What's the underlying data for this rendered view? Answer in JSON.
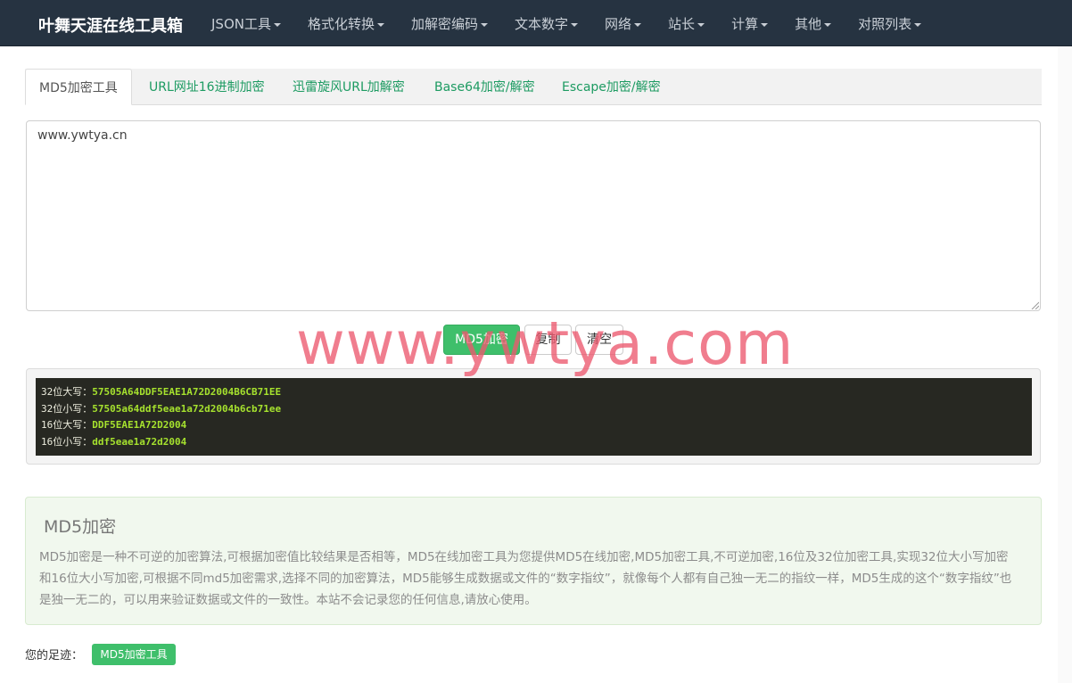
{
  "navbar": {
    "brand": "叶舞天涯在线工具箱",
    "items": [
      "JSON工具",
      "格式化转换",
      "加解密编码",
      "文本数字",
      "网络",
      "站长",
      "计算",
      "其他",
      "对照列表"
    ]
  },
  "tabs": [
    "MD5加密工具",
    "URL网址16进制加密",
    "迅雷旋风URL加解密",
    "Base64加密/解密",
    "Escape加密/解密"
  ],
  "input": {
    "value": "www.ywtya.cn"
  },
  "buttons": {
    "encrypt": "MD5加密",
    "copy": "复制",
    "clear": "清空"
  },
  "results": [
    {
      "label": "32位大写：",
      "value": "57505A64DDF5EAE1A72D2004B6CB71EE"
    },
    {
      "label": "32位小写：",
      "value": "57505a64ddf5eae1a72d2004b6cb71ee"
    },
    {
      "label": "16位大写：",
      "value": "DDF5EAE1A72D2004"
    },
    {
      "label": "16位小写：",
      "value": "ddf5eae1a72d2004"
    }
  ],
  "info": {
    "title": "MD5加密",
    "text": "MD5加密是一种不可逆的加密算法,可根据加密值比较结果是否相等，MD5在线加密工具为您提供MD5在线加密,MD5加密工具,不可逆加密,16位及32位加密工具,实现32位大小写加密和16位大小写加密,可根据不同md5加密需求,选择不同的加密算法，MD5能够生成数据或文件的“数字指纹”，就像每个人都有自己独一无二的指纹一样，MD5生成的这个“数字指纹”也是独一无二的，可以用来验证数据或文件的一致性。本站不会记录您的任何信息,请放心使用。"
  },
  "footer": {
    "label": "您的足迹：",
    "tag": "MD5加密工具"
  },
  "watermark": "www.ywtya.com",
  "colors": {
    "navbar": "#263341",
    "accent": "#3fbf6b",
    "link": "#1d9b62"
  }
}
